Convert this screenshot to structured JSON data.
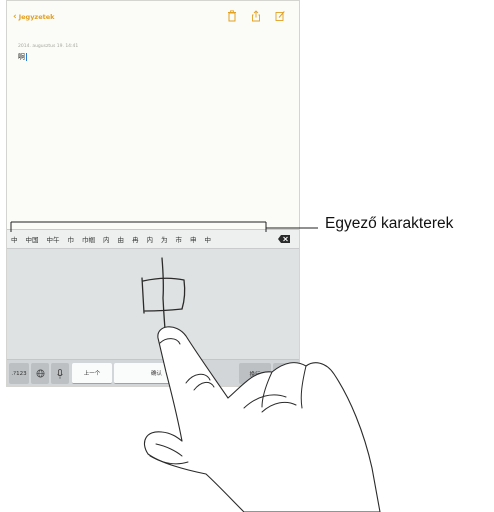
{
  "notes": {
    "back_label": "Jegyzetek",
    "date_text": "2014. augusztus 19. 14:41",
    "body_text": "啊",
    "toolbar_icons": [
      "trash-icon",
      "share-icon",
      "compose-icon"
    ],
    "accent_color": "#e1a020"
  },
  "keyboard": {
    "candidates": [
      "中",
      "中国",
      "中午",
      "巾",
      "巾帼",
      "内",
      "由",
      "冉",
      "内",
      "为",
      "市",
      "申",
      "中"
    ],
    "keys": {
      "numbers": ".?123",
      "previous": "上一个",
      "confirm": "确认",
      "return": "换行"
    },
    "icons": [
      "globe-icon",
      "microphone-icon",
      "delete-icon",
      "hide-keyboard-icon"
    ]
  },
  "callout": {
    "label": "Egyező karakterek"
  }
}
